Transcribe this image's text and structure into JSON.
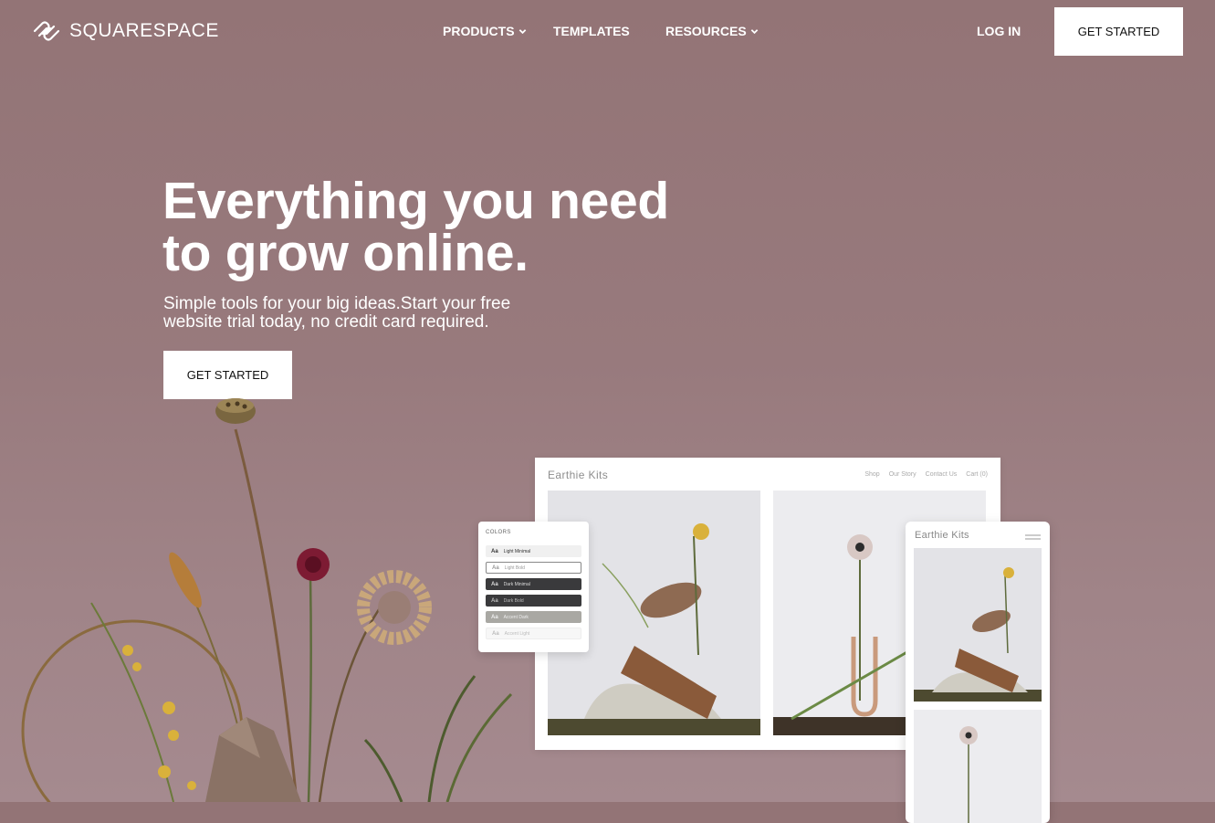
{
  "nav": {
    "brand": "SQUARESPACE",
    "items": [
      {
        "label": "PRODUCTS",
        "has_dropdown": true
      },
      {
        "label": "TEMPLATES",
        "has_dropdown": false
      },
      {
        "label": "RESOURCES",
        "has_dropdown": true
      }
    ],
    "login": "LOG IN",
    "cta": "GET STARTED"
  },
  "hero": {
    "headline_line1": "Everything you need",
    "headline_line2": "to grow online.",
    "subhead_line1": "Simple tools for your big ideas.Start your free",
    "subhead_line2": "website trial today, no credit card required.",
    "cta": "GET STARTED"
  },
  "mockup": {
    "desktop": {
      "brand": "Earthie Kits",
      "links": [
        "Shop",
        "Our Story",
        "Contact Us",
        "Cart (0)"
      ]
    },
    "colors_panel": {
      "title": "COLORS",
      "swatches": [
        {
          "label": "Light Minimal",
          "bg": "#f0f0f0",
          "fg": "#333333"
        },
        {
          "label": "Light Bold",
          "bg": "#ffffff",
          "fg": "#999999"
        },
        {
          "label": "Dark Minimal",
          "bg": "#3a3a3c",
          "fg": "#dddddd"
        },
        {
          "label": "Dark Bold",
          "bg": "#3a3a3c",
          "fg": "#bbbbbb"
        },
        {
          "label": "Accent Dark",
          "bg": "#a9a8a3",
          "fg": "#eeeeee"
        },
        {
          "label": "Accent Light",
          "bg": "#f7f7f7",
          "fg": "#bbbbbb"
        }
      ]
    },
    "mobile": {
      "brand": "Earthie Kits"
    }
  },
  "colors": {
    "background": "#987a7d",
    "text": "#ffffff",
    "button_bg": "#ffffff",
    "button_text": "#111111"
  },
  "icons": [
    "squarespace-logo-icon",
    "chevron-down-icon",
    "hamburger-menu-icon"
  ]
}
